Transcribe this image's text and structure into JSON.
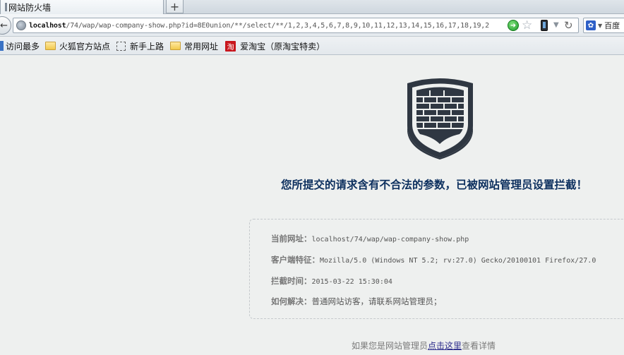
{
  "browser": {
    "tab_title": "网站防火墙",
    "new_tab_label": "+",
    "back_glyph": "←",
    "url_host": "localhost",
    "url_rest": "/74/wap/wap-company-show.php?id=8E0union/**/select/**/1,2,3,4,5,6,7,8,9,10,11,12,13,14,15,16,17,18,19,2",
    "search_engine": "百度",
    "icons": [
      "globe-icon",
      "go-icon",
      "star-icon",
      "phone-icon",
      "dropdown-icon",
      "reload-icon",
      "paw-icon"
    ]
  },
  "bookmarks": [
    {
      "label": "访问最多",
      "icon": "most-visited-icon"
    },
    {
      "label": "火狐官方站点",
      "icon": "folder-icon"
    },
    {
      "label": "新手上路",
      "icon": "dashed-page-icon"
    },
    {
      "label": "常用网址",
      "icon": "folder-icon"
    },
    {
      "label": "爱淘宝（原淘宝特卖）",
      "icon": "taobao-icon",
      "icon_text": "淘"
    }
  ],
  "page": {
    "title": "您所提交的请求含有不合法的参数，已被网站管理员设置拦截！",
    "details": [
      {
        "label": "当前网址：",
        "value": "localhost/74/wap/wap-company-show.php"
      },
      {
        "label": "客户端特征：",
        "value": "Mozilla/5.0 (Windows NT 5.2; rv:27.0) Gecko/20100101 Firefox/27.0"
      },
      {
        "label": "拦截时间：",
        "value": "2015-03-22 15:30:04"
      },
      {
        "label": "如何解决：",
        "value": "普通网站访客，请联系网站管理员；"
      }
    ],
    "footer_prefix": "如果您是网站管理员",
    "footer_link": "点击这里",
    "footer_suffix": "查看详情"
  },
  "colors": {
    "page_bg": "#eef0ef",
    "title": "#0c2f5e",
    "shield": "#2f3742"
  }
}
